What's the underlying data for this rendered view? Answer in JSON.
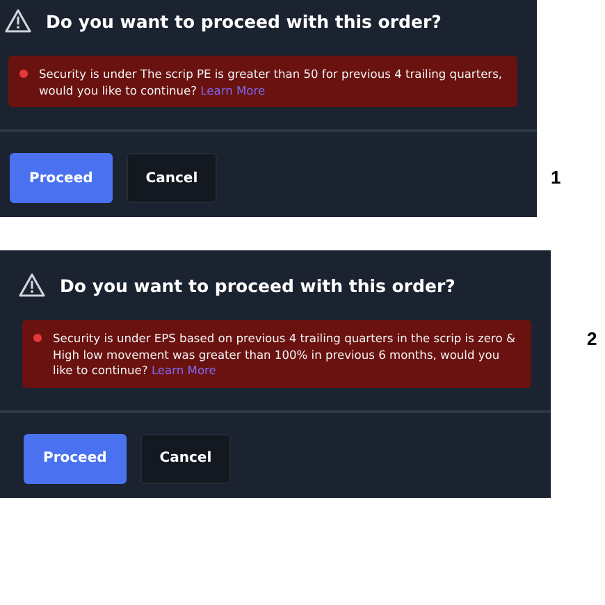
{
  "dialogs": [
    {
      "number": "1",
      "title": "Do you want to proceed with this order?",
      "alerts": [
        {
          "message": "Security is under The scrip PE is greater than 50 for previous 4 trailing quarters, would you like to continue?",
          "link": "Learn More",
          "color": "#e8393a"
        }
      ],
      "buttons": [
        {
          "label": "Proceed",
          "kind": "primary"
        },
        {
          "label": "Cancel",
          "kind": "secondary"
        }
      ]
    },
    {
      "number": "2",
      "title": "Do you want to proceed with this order?",
      "alerts": [
        {
          "message": "Security is under EPS based on previous 4 trailing quarters in the scrip is zero & High low movement was greater than 100% in previous 6 months, would you like to continue?",
          "link": "Learn More",
          "color": "#e8393a"
        }
      ],
      "buttons": [
        {
          "label": "Proceed",
          "kind": "primary"
        },
        {
          "label": "Cancel",
          "kind": "secondary"
        }
      ]
    }
  ]
}
